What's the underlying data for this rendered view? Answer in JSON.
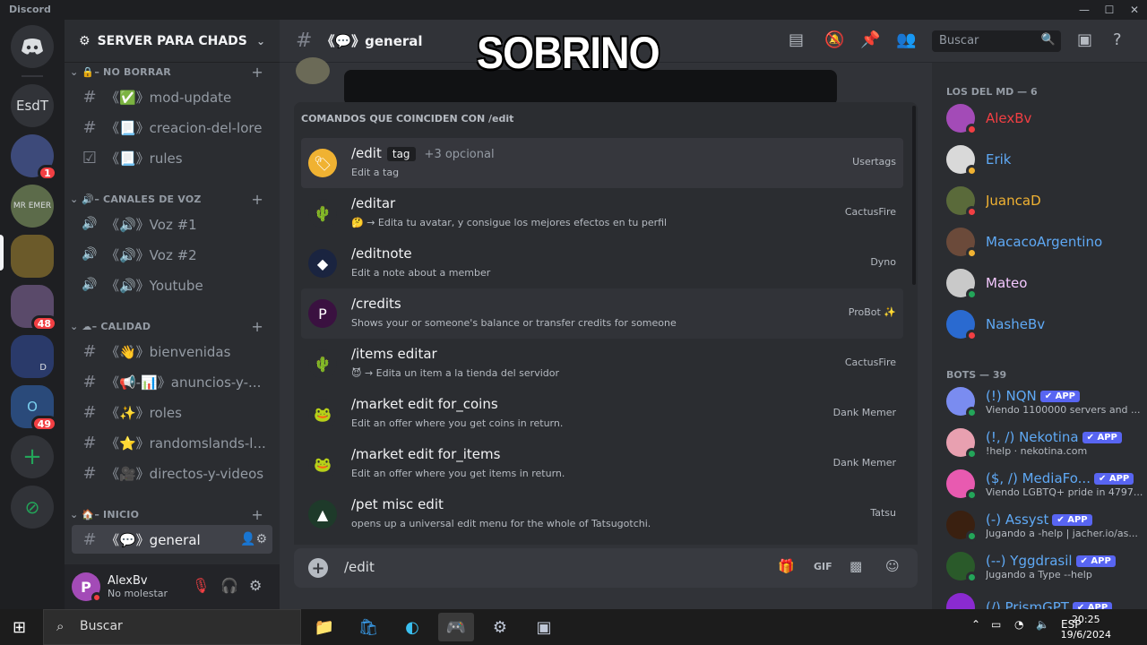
{
  "window": {
    "title": "Discord"
  },
  "servers": [
    {
      "label": "",
      "badge": ""
    },
    {
      "label": "EsdT",
      "badge": ""
    },
    {
      "label": "",
      "badge": "1"
    },
    {
      "label": "MR EMER",
      "badge": ""
    },
    {
      "label": "",
      "badge": ""
    },
    {
      "label": "",
      "badge": "48"
    },
    {
      "label": "D",
      "badge": ""
    },
    {
      "label": "O",
      "badge": "49"
    },
    {
      "label": "+",
      "badge": ""
    },
    {
      "label": "",
      "badge": ""
    }
  ],
  "guild": {
    "name": "SERVER PARA CHADS"
  },
  "categories": [
    {
      "label": "🔒– NO BORRAR"
    },
    {
      "label": "🔊– CANALES DE VOZ"
    },
    {
      "label": "☁– CALIDAD"
    },
    {
      "label": "🏠– INICIO"
    }
  ],
  "channels": [
    {
      "icon": "#",
      "label": "《✅》mod-update"
    },
    {
      "icon": "#",
      "label": "《📃》creacion-del-lore"
    },
    {
      "icon": "☑",
      "label": "《📃》rules"
    },
    {
      "icon": "🔊",
      "label": "《🔊》Voz #1"
    },
    {
      "icon": "🔊",
      "label": "《🔊》Voz #2"
    },
    {
      "icon": "🔊",
      "label": "《🔊》Youtube"
    },
    {
      "icon": "#",
      "label": "《👋》bienvenidas"
    },
    {
      "icon": "#",
      "label": "《📢-📊》anuncios-y-..."
    },
    {
      "icon": "#",
      "label": "《✨》roles"
    },
    {
      "icon": "#",
      "label": "《⭐》randomslands-l..."
    },
    {
      "icon": "#",
      "label": "《🎥》directos-y-videos"
    },
    {
      "icon": "#",
      "label": "《💬》general"
    }
  ],
  "user": {
    "name": "AlexBv",
    "status": "No molestar",
    "initial": "P"
  },
  "topbar": {
    "channel": "《💬》general",
    "search_placeholder": "Buscar"
  },
  "meme_text": "SOBRINO",
  "autocomplete": {
    "header": "COMANDOS QUE COINCIDEN CON /edit",
    "commands": [
      {
        "name": "/edit",
        "option": "tag",
        "more": "+3 opcional",
        "desc": "Edit a tag",
        "source": "Usertags",
        "icon_char": "🏷",
        "icon_color": "#f0b232"
      },
      {
        "name": "/editar",
        "option": "",
        "more": "",
        "desc": "🤔 → Edita tu avatar, y consigue los mejores efectos en tu perfil",
        "source": "CactusFire",
        "icon_char": "🌵",
        "icon_color": "#2b2d31"
      },
      {
        "name": "/editnote",
        "option": "",
        "more": "",
        "desc": "Edit a note about a member",
        "source": "Dyno",
        "icon_char": "◆",
        "icon_color": "#1a2440"
      },
      {
        "name": "/credits",
        "option": "",
        "more": "",
        "desc": "Shows your or someone's balance or transfer credits for someone",
        "source": "ProBot ✨",
        "icon_char": "P",
        "icon_color": "#3a1140"
      },
      {
        "name": "/items editar",
        "option": "",
        "more": "",
        "desc": "😈 → Edita un item a la tienda del servidor",
        "source": "CactusFire",
        "icon_char": "🌵",
        "icon_color": "#2b2d31"
      },
      {
        "name": "/market edit for_coins",
        "option": "",
        "more": "",
        "desc": "Edit an offer where you get coins in return.",
        "source": "Dank Memer",
        "icon_char": "🐸",
        "icon_color": "#2b2d31"
      },
      {
        "name": "/market edit for_items",
        "option": "",
        "more": "",
        "desc": "Edit an offer where you get items in return.",
        "source": "Dank Memer",
        "icon_char": "🐸",
        "icon_color": "#2b2d31"
      },
      {
        "name": "/pet misc edit",
        "option": "",
        "more": "",
        "desc": "opens up a universal edit menu for the whole of Tatsugotchi.",
        "source": "Tatsu",
        "icon_char": "▲",
        "icon_color": "#1e3a2a"
      }
    ]
  },
  "composer": {
    "value": "/edit"
  },
  "members": {
    "group1": "LOS DEL MD — 6",
    "list1": [
      {
        "name": "AlexBv",
        "color": "#f23f43",
        "avatar": "#a34bb7",
        "dot": "#f23f43"
      },
      {
        "name": "Erik",
        "color": "#5fa9f5",
        "avatar": "#d9d9d9",
        "dot": "#f0b232"
      },
      {
        "name": "JuancaD",
        "color": "#f0b232",
        "avatar": "#5a6a3a",
        "dot": "#f23f43"
      },
      {
        "name": "MacacoArgentino",
        "color": "#5fa9f5",
        "avatar": "#6b4a3a",
        "dot": "#f0b232"
      },
      {
        "name": "Mateo",
        "color": "#f4c8ff",
        "avatar": "#c9c9c9",
        "dot": "#23a559"
      },
      {
        "name": "NasheBv",
        "color": "#5fa9f5",
        "avatar": "#2a6ad0",
        "dot": "#f23f43"
      }
    ],
    "group2": "BOTS — 39",
    "list2": [
      {
        "name": "(!) NQN",
        "status": "Viendo 1100000 servers and ...",
        "avatar": "#7a8cf0",
        "dot": "#23a559",
        "app": "✔ APP"
      },
      {
        "name": "(!, /) Nekotina",
        "status": "!help · nekotina.com",
        "avatar": "#e8a0b0",
        "dot": "#23a559",
        "app": "✔ APP"
      },
      {
        "name": "($, /) MediaFo...",
        "status": "Viendo LGBTQ+ pride in 4797...",
        "avatar": "#e85ab0",
        "dot": "#23a559",
        "app": "✔ APP"
      },
      {
        "name": "(-) Assyst",
        "status": "Jugando a -help | jacher.io/as...",
        "avatar": "#3a2010",
        "dot": "#23a559",
        "app": "✔ APP"
      },
      {
        "name": "(--) Yggdrasil",
        "status": "Jugando a Type --help",
        "avatar": "#2a5a2a",
        "dot": "#23a559",
        "app": "✔ APP"
      },
      {
        "name": "(/) PrismGPT",
        "status": "",
        "avatar": "#8a2ad0",
        "dot": "#23a559",
        "app": "✔ APP"
      }
    ]
  },
  "taskbar": {
    "search": "Buscar",
    "lang": "ESP",
    "time": "20:25",
    "date": "19/6/2024"
  }
}
